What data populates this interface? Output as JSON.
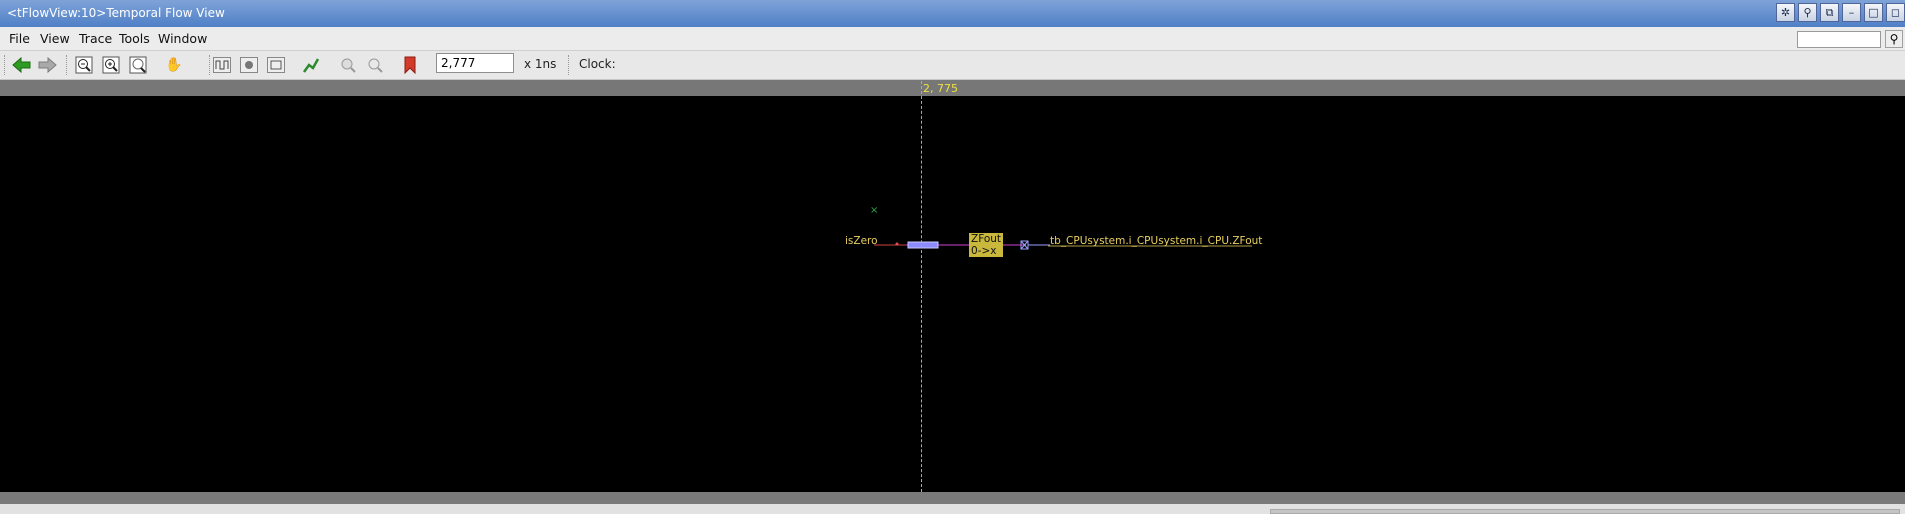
{
  "window": {
    "title": "<tFlowView:10>Temporal Flow View"
  },
  "menu": {
    "items": [
      "File",
      "View",
      "Trace",
      "Tools",
      "Window"
    ]
  },
  "toolbar": {
    "time_value": "2,777",
    "unit": "x 1ns",
    "clock_label": "Clock:",
    "icons": [
      "back-arrow-icon",
      "forward-arrow-icon",
      "zoom-out-icon",
      "zoom-in-icon",
      "zoom-100-icon",
      "pan-hand-icon",
      "waveform-icon",
      "schematic-icon",
      "source-icon",
      "trace-icon",
      "zoom-fit-icon",
      "search-icon",
      "bookmark-icon"
    ]
  },
  "canvas": {
    "cursor_label": "2, 775",
    "left_signal": "isZero",
    "node_name": "ZFout",
    "node_transition": "0->x",
    "right_signal": "tb_CPUsystem.i_CPUsystem.i_CPU.ZFout"
  },
  "colors": {
    "canvas_bg": "#000000",
    "signal_text": "#e8d060",
    "node_fill": "#c9b83b",
    "wire": "#d040d0",
    "titlebar": "#4f7fc6"
  }
}
